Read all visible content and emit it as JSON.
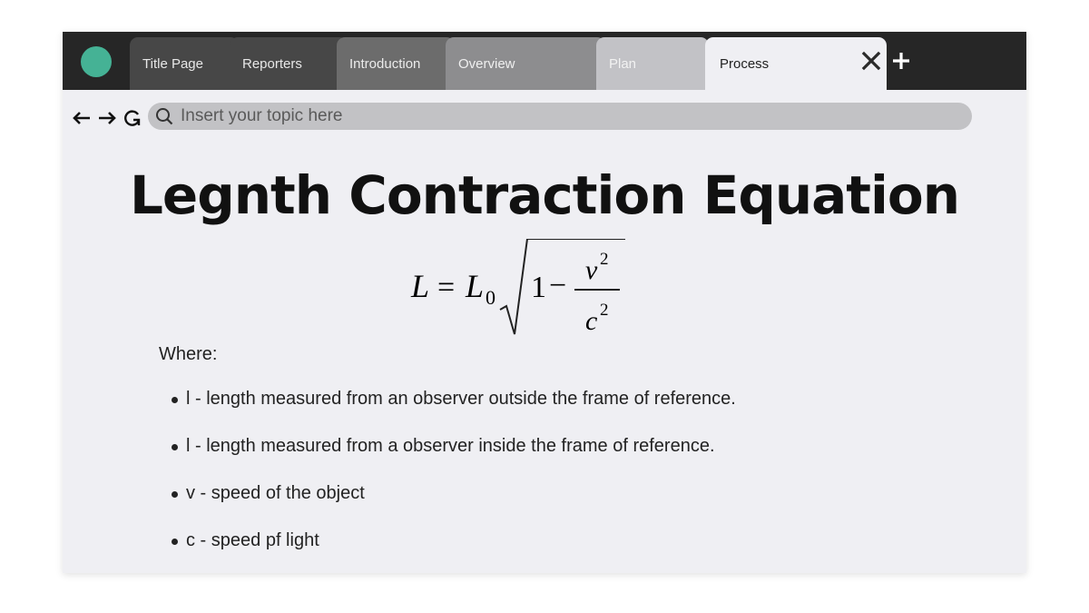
{
  "browser": {
    "brand_color": "#45b295",
    "tabs": [
      {
        "label": "Title Page",
        "active": false
      },
      {
        "label": "Reporters",
        "active": false
      },
      {
        "label": "Introduction",
        "active": false
      },
      {
        "label": "Overview",
        "active": false
      },
      {
        "label": "Plan",
        "active": false
      },
      {
        "label": "Process",
        "active": true
      }
    ],
    "icons": {
      "close": "close-icon",
      "new_tab": "plus-icon",
      "back": "arrow-left-icon",
      "forward": "arrow-right-icon",
      "reload": "reload-icon",
      "search": "search-icon"
    },
    "address_bar": {
      "value": "",
      "placeholder": "Insert your topic here"
    }
  },
  "page": {
    "title": "Legnth Contraction Equation",
    "equation": {
      "lhs": "L",
      "equals": "=",
      "base": "L",
      "base_subscript": "0",
      "one": "1",
      "minus": "−",
      "numerator": "v",
      "numerator_exp": "2",
      "denominator": "c",
      "denominator_exp": "2"
    },
    "where_label": "Where:",
    "definitions": [
      "l - length measured from an observer outside the frame of reference.",
      "l - length measured from a observer inside the frame of reference.",
      "v - speed of the object",
      "c - speed pf light"
    ]
  }
}
